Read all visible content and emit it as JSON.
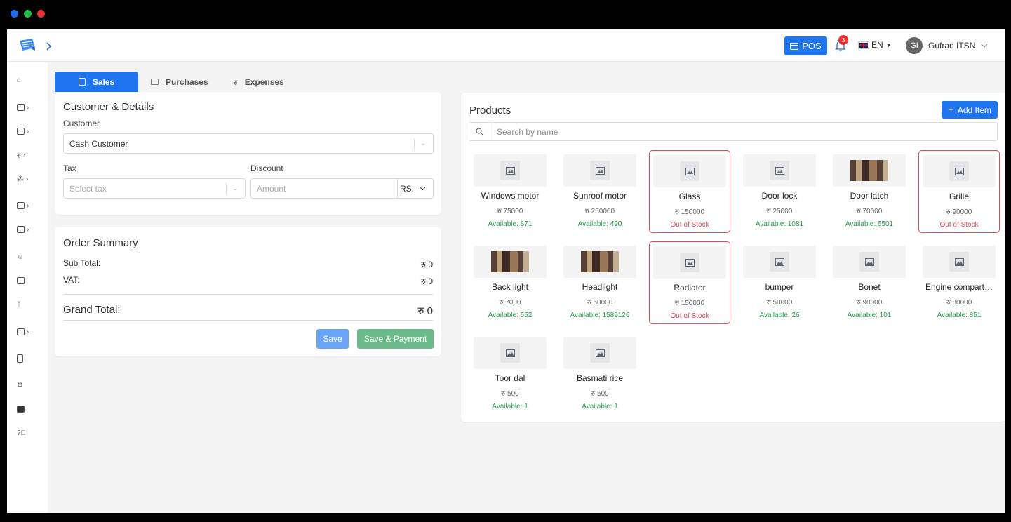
{
  "header": {
    "pos_label": "POS",
    "notifications_count": "3",
    "language": "EN",
    "user_initials": "GI",
    "user_name": "Gufran ITSN"
  },
  "tabs": [
    {
      "label": "Sales",
      "icon": "bag-icon",
      "active": true
    },
    {
      "label": "Purchases",
      "icon": "receipt-icon",
      "active": false
    },
    {
      "label": "Expenses",
      "icon": "rupee-icon",
      "active": false
    }
  ],
  "customer_card": {
    "title": "Customer & Details",
    "customer_label": "Customer",
    "customer_value": "Cash Customer",
    "tax_label": "Tax",
    "tax_placeholder": "Select tax",
    "discount_label": "Discount",
    "discount_placeholder": "Amount",
    "discount_unit": "RS."
  },
  "summary": {
    "title": "Order Summary",
    "subtotal_label": "Sub Total:",
    "subtotal_value": "रु 0",
    "vat_label": "VAT:",
    "vat_value": "रु 0",
    "grand_label": "Grand Total:",
    "grand_value": "रु 0",
    "save_label": "Save",
    "save_payment_label": "Save & Payment"
  },
  "products": {
    "title": "Products",
    "add_label": "Add Item",
    "search_placeholder": "Search by name",
    "items": [
      {
        "name": "Windows motor",
        "price": "रु 75000",
        "availability": "Available: 871",
        "out": false,
        "photo": false
      },
      {
        "name": "Sunroof motor",
        "price": "रु 250000",
        "availability": "Available: 490",
        "out": false,
        "photo": false
      },
      {
        "name": "Glass",
        "price": "रु 150000",
        "availability": "Out of Stock",
        "out": true,
        "photo": false
      },
      {
        "name": "Door lock",
        "price": "रु 25000",
        "availability": "Available: 1081",
        "out": false,
        "photo": false
      },
      {
        "name": "Door latch",
        "price": "रु 70000",
        "availability": "Available: 6501",
        "out": false,
        "photo": true
      },
      {
        "name": "Grille",
        "price": "रु 90000",
        "availability": "Out of Stock",
        "out": true,
        "photo": false
      },
      {
        "name": "Back light",
        "price": "रु 7000",
        "availability": "Available: 552",
        "out": false,
        "photo": true
      },
      {
        "name": "Headlight",
        "price": "रु 50000",
        "availability": "Available: 1589126",
        "out": false,
        "photo": true
      },
      {
        "name": "Radiator",
        "price": "रु 150000",
        "availability": "Out of Stock",
        "out": true,
        "photo": false
      },
      {
        "name": "bumper",
        "price": "रु 50000",
        "availability": "Available: 26",
        "out": false,
        "photo": false
      },
      {
        "name": "Bonet",
        "price": "रु 90000",
        "availability": "Available: 101",
        "out": false,
        "photo": false
      },
      {
        "name": "Engine compart…",
        "price": "रु 80000",
        "availability": "Available: 851",
        "out": false,
        "photo": false
      },
      {
        "name": "Toor dal",
        "price": "रु 500",
        "availability": "Available: 1",
        "out": false,
        "photo": false
      },
      {
        "name": "Basmati rice",
        "price": "रु 500",
        "availability": "Available: 1",
        "out": false,
        "photo": false
      }
    ]
  },
  "colors": {
    "primary": "#1f74f0",
    "success": "#2a9d4e",
    "danger": "#e14b5a"
  }
}
